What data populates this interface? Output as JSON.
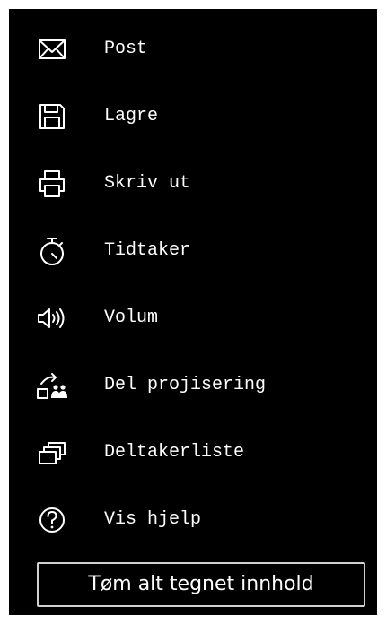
{
  "menu": {
    "items": [
      {
        "label": "Post",
        "icon": "mail-icon"
      },
      {
        "label": "Lagre",
        "icon": "save-icon"
      },
      {
        "label": "Skriv ut",
        "icon": "printer-icon"
      },
      {
        "label": "Tidtaker",
        "icon": "stopwatch-icon"
      },
      {
        "label": "Volum",
        "icon": "speaker-icon"
      },
      {
        "label": "Del projisering",
        "icon": "share-projection-icon"
      },
      {
        "label": "Deltakerliste",
        "icon": "participant-list-icon"
      },
      {
        "label": "Vis hjelp",
        "icon": "help-icon"
      }
    ]
  },
  "clear_button": {
    "label": "Tøm alt tegnet innhold"
  },
  "colors": {
    "background": "#000000",
    "foreground": "#ffffff",
    "button_border": "#d0d0d0"
  }
}
